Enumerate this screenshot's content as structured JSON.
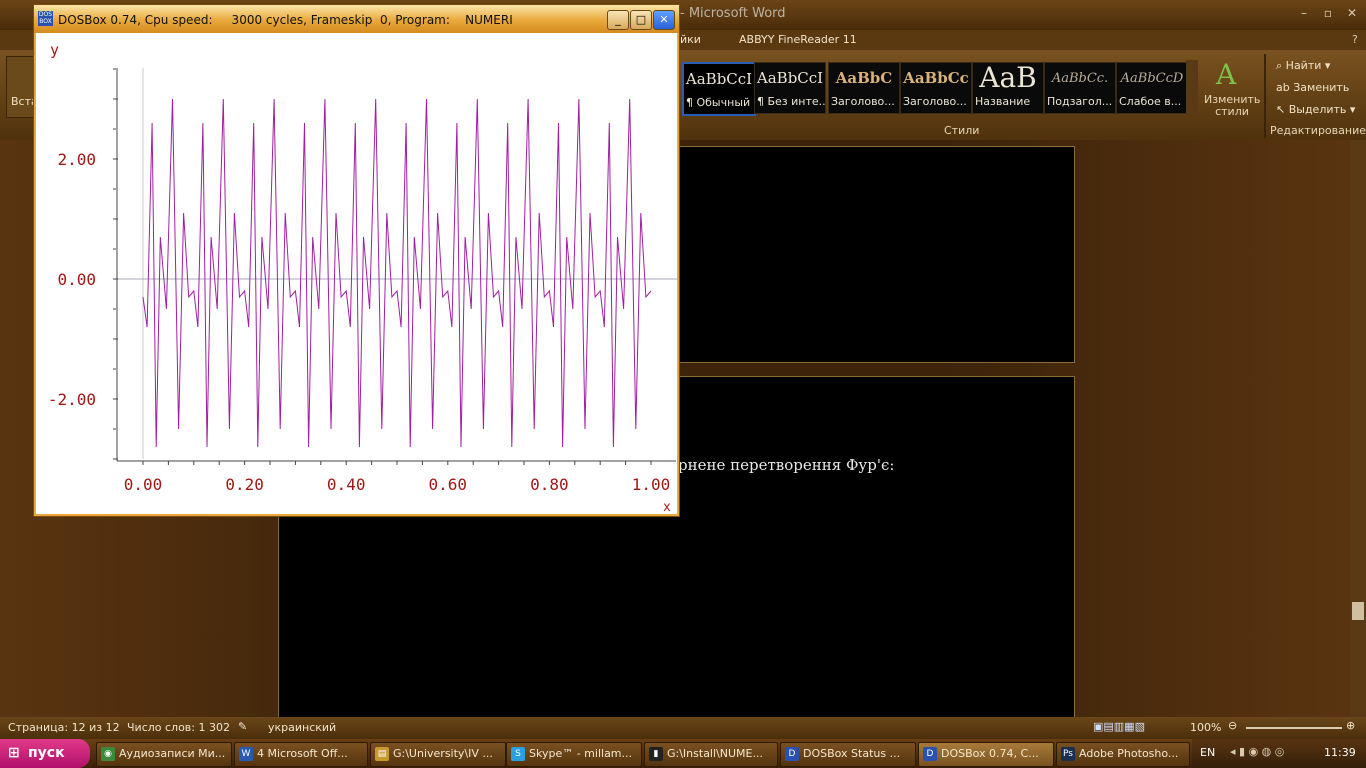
{
  "word": {
    "title": "- Microsoft Word",
    "tabs": [
      "йки",
      "ABBYY FineReader 11"
    ],
    "paste_label": "Вста",
    "styles": [
      {
        "sample": "AaBbCcI",
        "label": "¶ Обычный",
        "selected": true
      },
      {
        "sample": "AaBbCcI",
        "label": "¶ Без инте..."
      },
      {
        "sample": "AaBbC",
        "label": "Заголово..."
      },
      {
        "sample": "AaBbCc",
        "label": "Заголово..."
      },
      {
        "sample": "AaB",
        "label": "Название"
      },
      {
        "sample": "AaBbCc.",
        "label": "Подзагол..."
      },
      {
        "sample": "AaBbCcD",
        "label": "Слабое в..."
      }
    ],
    "change_styles": "Изменить стили",
    "styles_group": "Стили",
    "editing": {
      "find": "Найти",
      "replace": "Заменить",
      "select": "Выделить",
      "group": "Редактирование"
    },
    "doc_text": "рнене перетворення Фур'є:",
    "status": {
      "page": "Страница: 12 из 12",
      "words": "Число слов: 1 302",
      "lang": "украинский",
      "zoom": "100%"
    }
  },
  "dosbox": {
    "title": "DOSBox 0.74, Cpu speed:     3000 cycles, Frameskip  0, Program:    NUMERI",
    "minimize": "_",
    "maximize": "□",
    "close": "✕"
  },
  "chart_data": {
    "type": "line",
    "ylabel": "y",
    "xlabel": "x",
    "xlim": [
      0,
      1
    ],
    "ylim": [
      -3.0,
      3.5
    ],
    "xticks": [
      "0.00",
      "0.20",
      "0.40",
      "0.60",
      "0.80",
      "1.00"
    ],
    "yticks": [
      "2.00",
      "0.00",
      "-2.00"
    ],
    "zero_line": true,
    "color": "#a020a0",
    "period": 0.1,
    "x": [
      0.0,
      0.008,
      0.018,
      0.026,
      0.034,
      0.046,
      0.058,
      0.07,
      0.08,
      0.09,
      0.1
    ],
    "y": [
      -0.3,
      -0.8,
      2.6,
      -2.8,
      0.7,
      -0.5,
      3.0,
      -2.5,
      1.1,
      -0.3,
      -0.2
    ]
  },
  "taskbar": {
    "start": "пуск",
    "tasks": [
      {
        "icon": "chrome-icon",
        "label": "Аудиозаписи Ми..."
      },
      {
        "icon": "word-icon",
        "label": "4 Microsoft Off..."
      },
      {
        "icon": "folder-icon",
        "label": "G:\\University\\IV ..."
      },
      {
        "icon": "skype-icon",
        "label": "Skype™ - millam..."
      },
      {
        "icon": "cmd-icon",
        "label": "G:\\Install\\NUME..."
      },
      {
        "icon": "dosbox-icon",
        "label": "DOSBox Status ..."
      },
      {
        "icon": "dosbox-icon",
        "label": "DOSBox 0.74, C...",
        "active": true
      },
      {
        "icon": "photoshop-icon",
        "label": "Adobe Photosho..."
      }
    ],
    "lang": "EN",
    "clock": "11:39"
  }
}
